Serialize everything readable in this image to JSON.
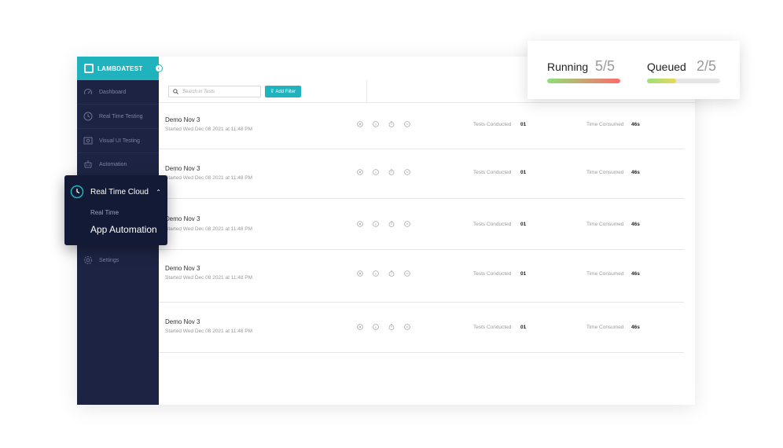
{
  "brand": {
    "name": "LAMBDATEST"
  },
  "sidebar": {
    "items": [
      {
        "label": "Dashboard",
        "icon": "speedometer-icon"
      },
      {
        "label": "Real Time Testing",
        "icon": "clock-icon"
      },
      {
        "label": "Visual UI Testing",
        "icon": "eye-icon"
      },
      {
        "label": "Automation",
        "icon": "robot-icon"
      },
      {
        "label": "Settings",
        "icon": "gear-icon"
      }
    ]
  },
  "popup": {
    "title": "Real Time Cloud",
    "sub_items": [
      "Real Time",
      "App Automation"
    ]
  },
  "toolbar": {
    "search_placeholder": "Search in Tests",
    "filter_label": "Add Filter"
  },
  "tests": [
    {
      "title": "Demo Nov 3",
      "started": "Started Wed Dec 08 2021 at 11:48 PM",
      "tests_label": "Tests Conducted",
      "tests_value": "01",
      "time_label": "Time Consumed",
      "time_value": "46s"
    },
    {
      "title": "Demo Nov 3",
      "started": "Started Wed Dec 08 2021 at 11:48 PM",
      "tests_label": "Tests Conducted",
      "tests_value": "01",
      "time_label": "Time Consumed",
      "time_value": "46s"
    },
    {
      "title": "Demo Nov 3",
      "started": "Started Wed Dec 08 2021 at 11:48 PM",
      "tests_label": "Tests Conducted",
      "tests_value": "01",
      "time_label": "Time Consumed",
      "time_value": "46s"
    },
    {
      "title": "Demo Nov 3",
      "started": "Started Wed Dec 08 2021 at 11:48 PM",
      "tests_label": "Tests Conducted",
      "tests_value": "01",
      "time_label": "Time Consumed",
      "time_value": "46s"
    },
    {
      "title": "Demo Nov 3",
      "started": "Started Wed Dec 08 2021 at 11:48 PM",
      "tests_label": "Tests Conducted",
      "tests_value": "01",
      "time_label": "Time Consumed",
      "time_value": "46s"
    }
  ],
  "status": {
    "running_label": "Running",
    "running_count": "5/5",
    "running_fraction": 1.0,
    "queued_label": "Queued",
    "queued_count": "2/5",
    "queued_fraction": 0.4
  },
  "colors": {
    "accent": "#20b2bd",
    "sidebar_bg": "#1d2443",
    "popup_bg": "#131a36"
  }
}
